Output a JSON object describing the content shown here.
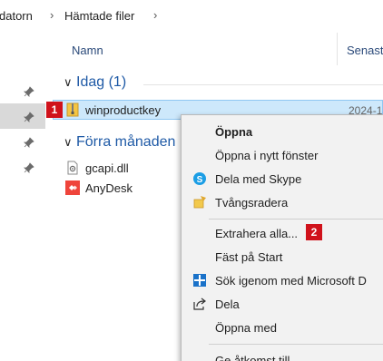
{
  "breadcrumb": {
    "items": [
      "datorn",
      "Hämtade filer"
    ],
    "separator": "›"
  },
  "columns": {
    "name": "Namn",
    "date": "Senast"
  },
  "groups": [
    {
      "label": "Idag (1)",
      "chevron": "∨",
      "files": [
        {
          "name": "winproductkey",
          "icon": "zip-folder-icon",
          "date": "2024-1"
        }
      ]
    },
    {
      "label": "Förra månaden",
      "chevron": "∨",
      "files": [
        {
          "name": "gcapi.dll",
          "icon": "dll-file-icon"
        },
        {
          "name": "AnyDesk",
          "icon": "anydesk-icon"
        }
      ]
    }
  ],
  "badges": [
    "1",
    "2"
  ],
  "context_menu": {
    "items": [
      {
        "label": "Öppna",
        "bold": true
      },
      {
        "label": "Öppna i nytt fönster"
      },
      {
        "label": "Dela med Skype",
        "icon": "skype-icon"
      },
      {
        "label": "Tvångsradera",
        "icon": "force-delete-icon"
      },
      {
        "label": "Extrahera alla..."
      },
      {
        "label": "Fäst på Start"
      },
      {
        "label": "Sök igenom med Microsoft D",
        "icon": "defender-icon"
      },
      {
        "label": "Dela",
        "icon": "share-icon"
      },
      {
        "label": "Öppna med"
      },
      {
        "label": "Ge åtkomst till"
      }
    ]
  },
  "colors": {
    "accent": "#1f5aa6",
    "selection": "#cde8fb",
    "badge": "#d0121b"
  }
}
